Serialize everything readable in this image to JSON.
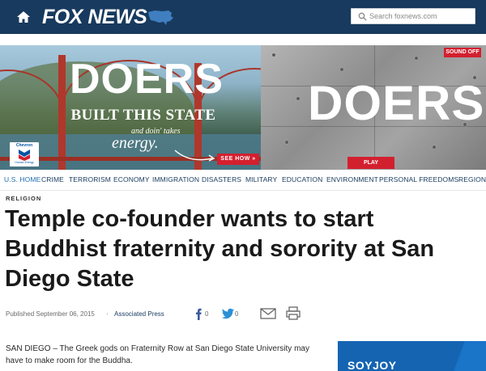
{
  "header": {
    "logo_text": "FOX NEWS",
    "search_placeholder": "Search foxnews.com",
    "bg_color": "#183a5e"
  },
  "ad_banner": {
    "left_headline": "DOERS",
    "left_subline": "BUILT THIS STATE",
    "left_tag_small": "and doin' takes",
    "left_tag_large": "energy.",
    "cta_left": "SEE HOW »",
    "sponsor_name": "Chevron",
    "sponsor_tagline": "Human Energy",
    "right_headline": "DOERS",
    "sound_button": "SOUND OFF",
    "play_button": "PLAY"
  },
  "nav": {
    "items": [
      "U.S. HOME",
      "CRIME",
      "TERRORISM",
      "ECONOMY",
      "IMMIGRATION",
      "DISASTERS",
      "MILITARY",
      "EDUCATION",
      "ENVIRONMENT",
      "PERSONAL FREEDOMS",
      "REGION"
    ],
    "active_index": 0
  },
  "article": {
    "category": "RELIGION",
    "headline": "Temple co-founder wants to start Buddhist fraternity and sorority at San Diego State",
    "published": "Published September 06, 2015",
    "separator": "·",
    "source": "Associated Press",
    "facebook_count": "0",
    "twitter_count": "0",
    "body_start": "SAN DIEGO –  The Greek gods on Fraternity Row at San Diego State University may have to make room for the Buddha."
  },
  "side_ad": {
    "brand": "SOYJOY"
  }
}
